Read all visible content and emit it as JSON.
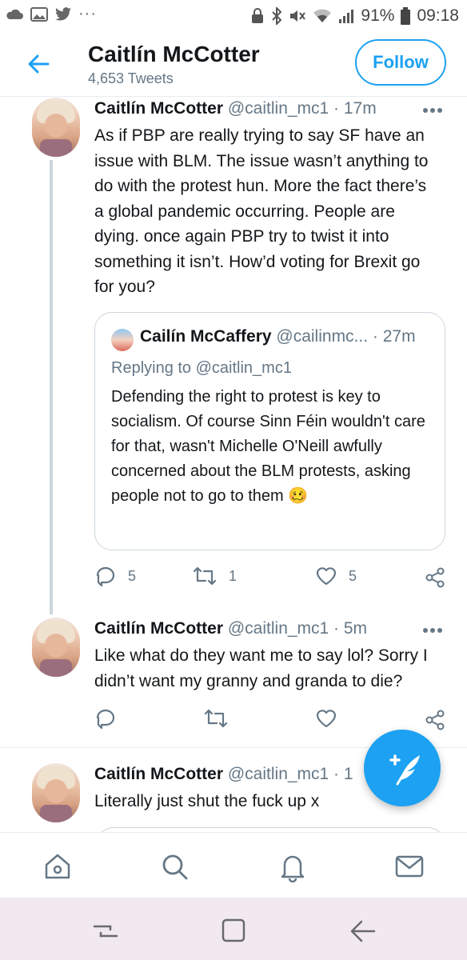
{
  "status_bar": {
    "battery": "91%",
    "time": "09:18"
  },
  "header": {
    "back_icon": "back-arrow-icon",
    "title": "Caitlín McCotter",
    "subtitle": "4,653 Tweets",
    "follow_label": "Follow"
  },
  "tweets": [
    {
      "name": "Caitlín McCotter",
      "handle": "@caitlin_mc1 · 17m",
      "text": "As if PBP are really trying to say SF have an issue with BLM. The issue wasn’t anything to do with the protest hun. More the fact there’s a global pandemic occurring. People are dying. once again PBP try to twist it into something it isn’t. How’d voting for Brexit go for you?",
      "quote": {
        "name": "Cailín McCaffery",
        "handle": "@cailinmc... · 27m",
        "replying": "Replying to @caitlin_mc1",
        "text": "Defending the right to protest is key to socialism. Of course Sinn Féin wouldn't care for that, wasn't Michelle O'Neill awfully concerned about the BLM protests, asking people not to go to them",
        "emoji": "🥴"
      },
      "replies": "5",
      "retweets": "1",
      "likes": "5"
    },
    {
      "name": "Caitlín McCotter",
      "handle": "@caitlin_mc1 · 5m",
      "text": "Like what do they want me to say lol? Sorry I didn’t want my granny and granda to die?",
      "replies": "",
      "retweets": "",
      "likes": ""
    },
    {
      "name": "Caitlín McCotter",
      "handle": "@caitlin_mc1 · 1",
      "text": "Literally just shut the fuck up x"
    }
  ],
  "icons": {
    "more": "more-dots-icon",
    "reply": "reply-icon",
    "retweet": "retweet-icon",
    "like": "heart-icon",
    "share": "share-icon",
    "compose": "compose-tweet-icon",
    "home": "home-icon",
    "search": "search-icon",
    "notifications": "bell-icon",
    "messages": "mail-icon"
  },
  "colors": {
    "accent": "#1da1f2",
    "muted": "#657786",
    "border": "#ccd6dd"
  }
}
